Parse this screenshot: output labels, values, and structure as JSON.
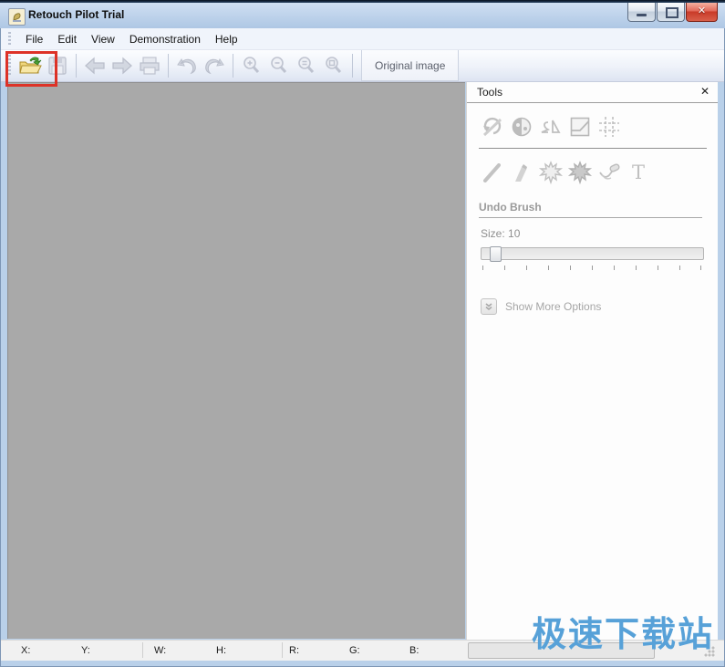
{
  "window": {
    "title": "Retouch Pilot Trial",
    "controls": {
      "minimize": "minimize-icon",
      "maximize": "maximize-icon",
      "close": "close-icon",
      "close_glyph": "x"
    }
  },
  "menu": {
    "items": [
      {
        "label": "File"
      },
      {
        "label": "Edit"
      },
      {
        "label": "View"
      },
      {
        "label": "Demonstration"
      },
      {
        "label": "Help"
      }
    ]
  },
  "toolbar": {
    "icons": [
      "open-image",
      "save",
      "back",
      "forward",
      "print",
      "undo",
      "redo",
      "zoom-in",
      "zoom-out",
      "zoom-actual",
      "zoom-fit"
    ],
    "original_image_label": "Original image",
    "highlight_color": "#dd3227"
  },
  "tools_panel": {
    "title": "Tools",
    "close_glyph": "x",
    "icons_row1": [
      "rotate-tool",
      "tone-tool",
      "mirror-tool",
      "levels-tool",
      "grid-tool"
    ],
    "icons_row2": [
      "scratch-tool",
      "brush-tool",
      "spot-tool",
      "spot-dark-tool",
      "patch-tool",
      "text-tool"
    ],
    "section_label": "Undo Brush",
    "size_label": "Size:",
    "size_value": "10",
    "show_more_label": "Show More Options"
  },
  "status_bar": {
    "fields": [
      "X:",
      "Y:",
      "W:",
      "H:",
      "R:",
      "G:",
      "B:"
    ]
  },
  "watermark": "极速下载站",
  "colors": {
    "titlebar": "#c0d4ec",
    "toolbar": "#e8edf7",
    "canvas": "#a9a9a9",
    "panel": "#fdfdfd",
    "watermark_blue": "#57a1d8",
    "close_red": "#c93a28"
  }
}
